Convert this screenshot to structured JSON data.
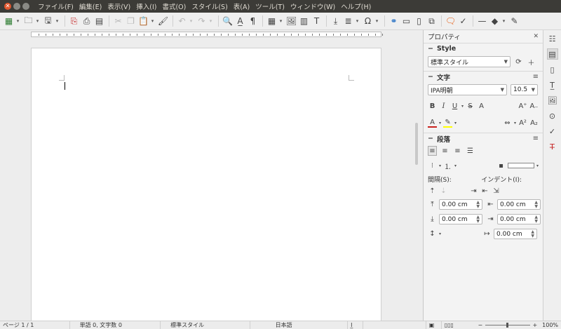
{
  "menubar": {
    "items": [
      "ファイル(F)",
      "編集(E)",
      "表示(V)",
      "挿入(I)",
      "書式(O)",
      "スタイル(S)",
      "表(A)",
      "ツール(T)",
      "ウィンドウ(W)",
      "ヘルプ(H)"
    ]
  },
  "toolbar": {
    "icons": [
      "table-icon",
      "open-icon",
      "save-icon",
      "export-pdf-icon",
      "print-icon",
      "print-preview-icon",
      "cut-icon",
      "copy-icon",
      "paste-icon",
      "clone-formatting-icon",
      "undo-icon",
      "redo-icon",
      "find-replace-icon",
      "spellcheck-icon",
      "formatting-marks-icon",
      "insert-table-icon",
      "insert-image-icon",
      "insert-chart-icon",
      "insert-textbox-icon",
      "insert-pagebreak-icon",
      "insert-field-icon",
      "special-character-icon",
      "hyperlink-icon",
      "footnote-icon",
      "insert-comment-icon",
      "track-changes-icon",
      "line-icon",
      "shapes-icon",
      "draw-functions-icon"
    ]
  },
  "sidebar": {
    "title": "プロパティ",
    "style_section": "Style",
    "style_value": "標準スタイル",
    "char_section": "文字",
    "font_name": "IPA明朝",
    "font_size": "10.5",
    "para_section": "段落",
    "spacing_label": "間隔(S):",
    "indent_label": "インデント(I):",
    "above_spacing": "0.00 cm",
    "below_spacing": "0.00 cm",
    "before_indent": "0.00 cm",
    "after_indent": "0.00 cm",
    "first_line_indent": "0.00 cm"
  },
  "statusbar": {
    "page": "ページ 1 / 1",
    "words": "単語 0, 文字数 0",
    "style": "標準スタイル",
    "language": "日本語",
    "zoom": "100%"
  },
  "colors": {
    "menubar_bg": "#3c3b37",
    "close_button": "#e2572e",
    "font_color_underline": "#c9211e",
    "highlight_color": "#ffff00"
  }
}
